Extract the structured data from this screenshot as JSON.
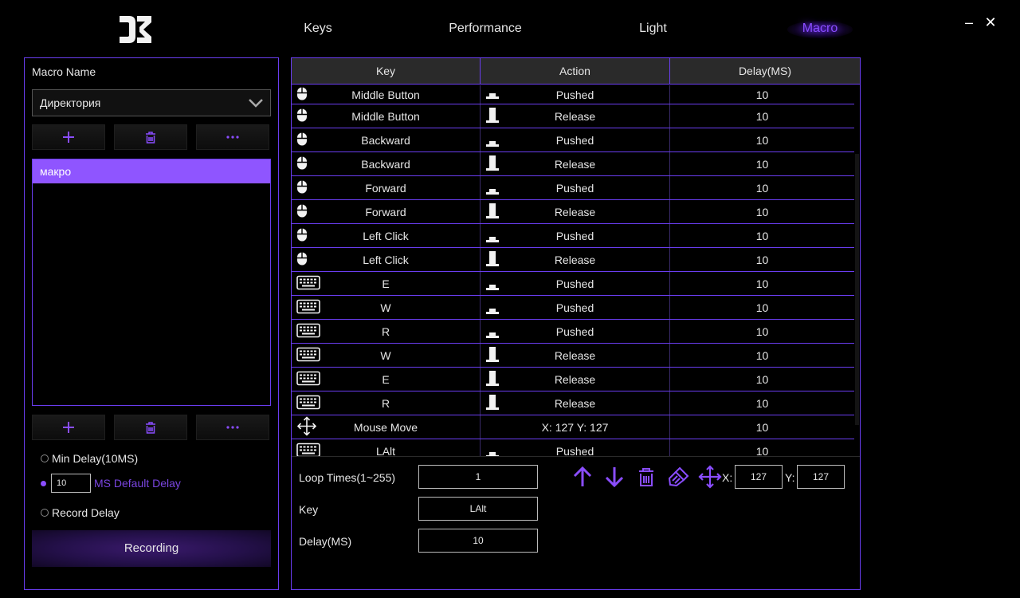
{
  "nav": {
    "tabs": [
      {
        "label": "Keys"
      },
      {
        "label": "Performance"
      },
      {
        "label": "Light"
      },
      {
        "label": "Macro"
      }
    ],
    "active": "Macro"
  },
  "window": {
    "minimize": "–",
    "close": "✕"
  },
  "left": {
    "title": "Macro Name",
    "directory_value": "Директория",
    "macros": [
      "макро"
    ],
    "delay_options": {
      "min_delay": "Min Delay(10MS)",
      "default_value": "10",
      "default_label": "MS Default Delay",
      "record_delay": "Record Delay",
      "selected": "default"
    },
    "record_label": "Recording"
  },
  "table": {
    "headers": [
      "Key",
      "Action",
      "Delay(MS)"
    ],
    "rows": [
      {
        "type": "mouse",
        "key": "Middle Button",
        "action": "Pushed",
        "delay": "10"
      },
      {
        "type": "mouse",
        "key": "Middle Button",
        "action": "Release",
        "delay": "10"
      },
      {
        "type": "mouse",
        "key": "Backward",
        "action": "Pushed",
        "delay": "10"
      },
      {
        "type": "mouse",
        "key": "Backward",
        "action": "Release",
        "delay": "10"
      },
      {
        "type": "mouse",
        "key": "Forward",
        "action": "Pushed",
        "delay": "10"
      },
      {
        "type": "mouse",
        "key": "Forward",
        "action": "Release",
        "delay": "10"
      },
      {
        "type": "mouse",
        "key": "Left Click",
        "action": "Pushed",
        "delay": "10"
      },
      {
        "type": "mouse",
        "key": "Left Click",
        "action": "Release",
        "delay": "10"
      },
      {
        "type": "keyboard",
        "key": "E",
        "action": "Pushed",
        "delay": "10"
      },
      {
        "type": "keyboard",
        "key": "W",
        "action": "Pushed",
        "delay": "10"
      },
      {
        "type": "keyboard",
        "key": "R",
        "action": "Pushed",
        "delay": "10"
      },
      {
        "type": "keyboard",
        "key": "W",
        "action": "Release",
        "delay": "10"
      },
      {
        "type": "keyboard",
        "key": "E",
        "action": "Release",
        "delay": "10"
      },
      {
        "type": "keyboard",
        "key": "R",
        "action": "Release",
        "delay": "10"
      },
      {
        "type": "move",
        "key": "Mouse Move",
        "action": "X: 127 Y: 127",
        "delay": "10"
      },
      {
        "type": "keyboard",
        "key": "LAlt",
        "action": "Pushed",
        "delay": "10"
      }
    ]
  },
  "controls": {
    "loop_label": "Loop Times(1~255)",
    "loop_value": "1",
    "key_label": "Key",
    "key_value": "LAlt",
    "delay_label": "Delay(MS)",
    "delay_value": "10",
    "x_label": "X:",
    "x_value": "127",
    "y_label": "Y:",
    "y_value": "127"
  },
  "colors": {
    "accent": "#8a4dff",
    "border": "#6a3df0",
    "selected_item": "#8f55ff"
  }
}
